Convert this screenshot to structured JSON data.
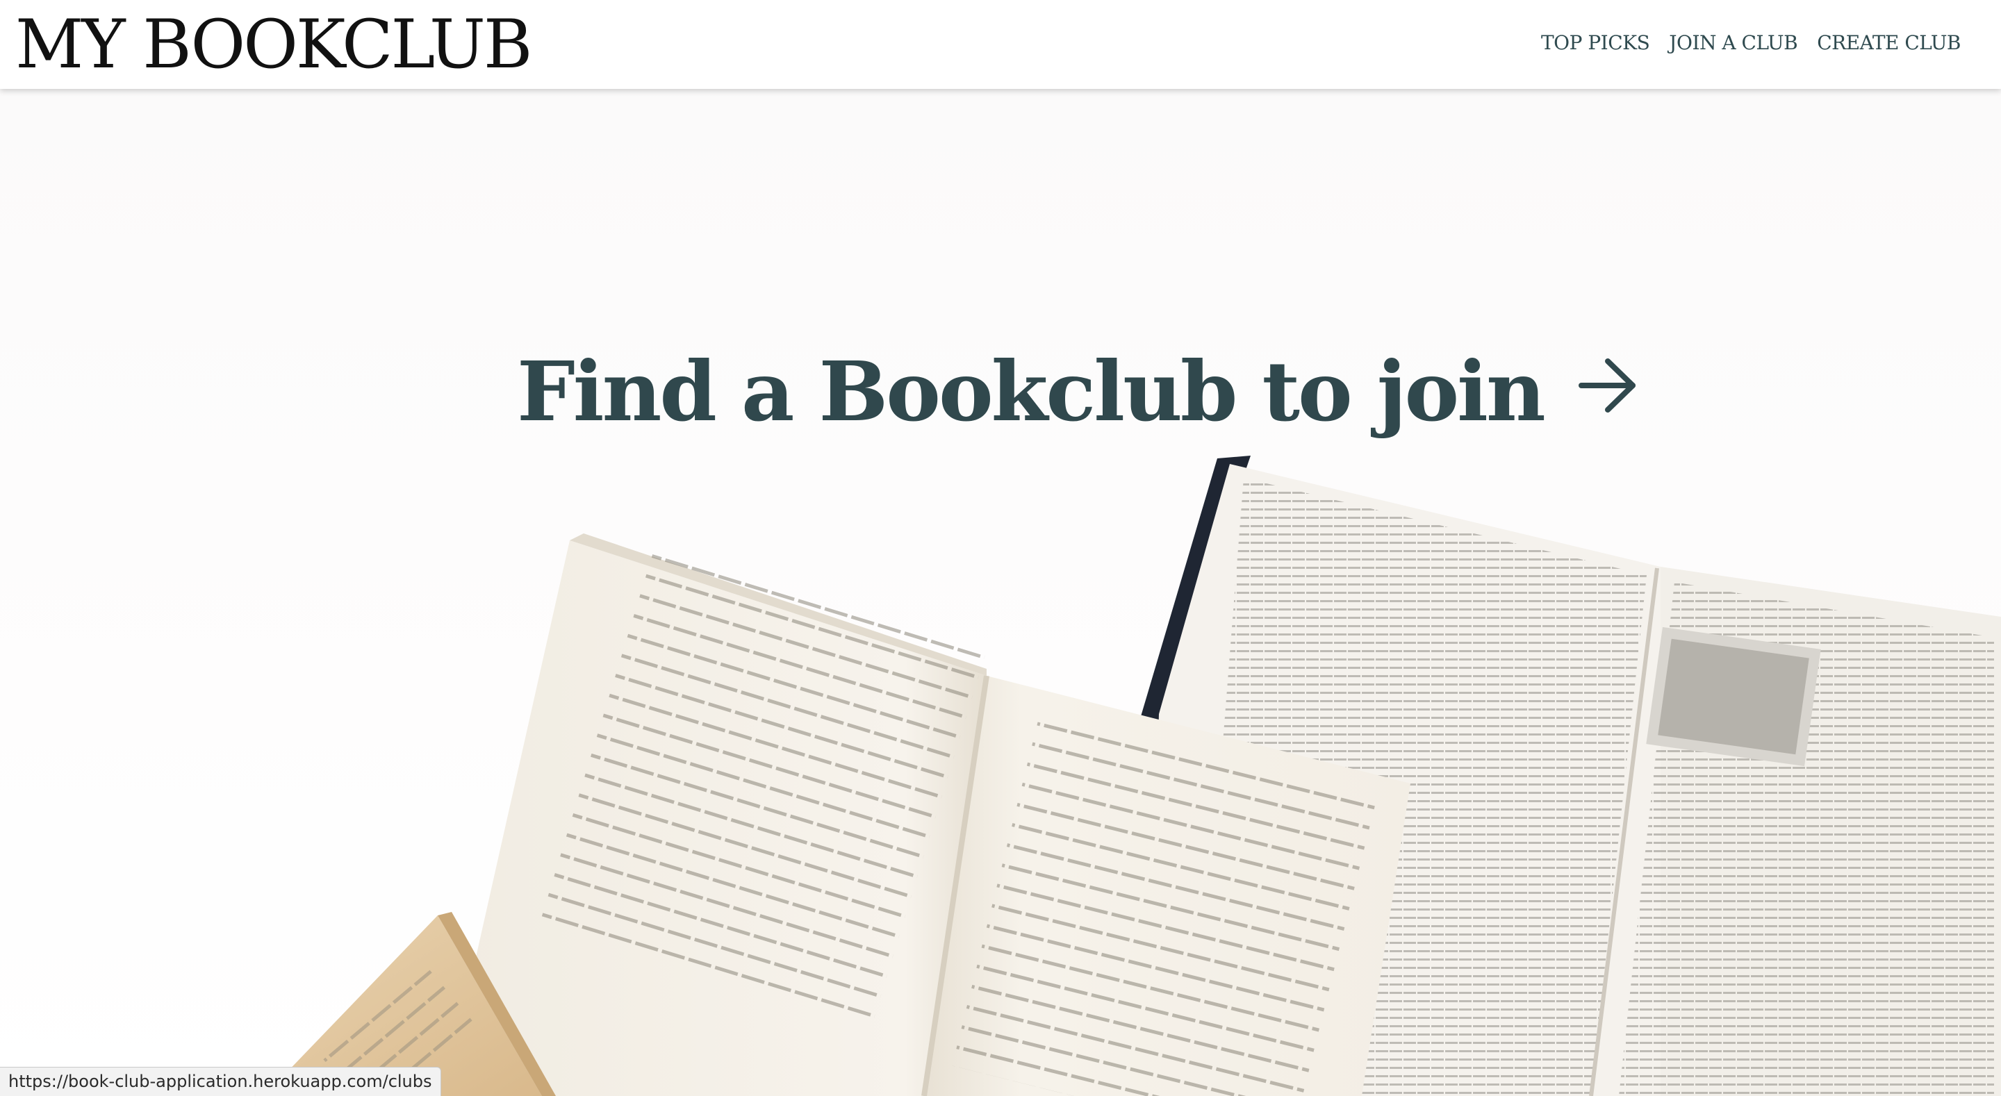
{
  "header": {
    "brand": "MY BOOKCLUB",
    "nav": [
      {
        "label": "TOP PICKS"
      },
      {
        "label": "JOIN A CLUB"
      },
      {
        "label": "CREATE CLUB"
      }
    ]
  },
  "hero": {
    "title": "Find a Bookclub to join",
    "arrow_icon": "arrow-right-icon",
    "image": "open-books-photo"
  },
  "status_bar": {
    "url": "https://book-club-application.herokuapp.com/clubs"
  },
  "colors": {
    "accent": "#30484d",
    "nav_text": "#2f4a4f",
    "brand_text": "#111111",
    "background": "#ffffff"
  }
}
